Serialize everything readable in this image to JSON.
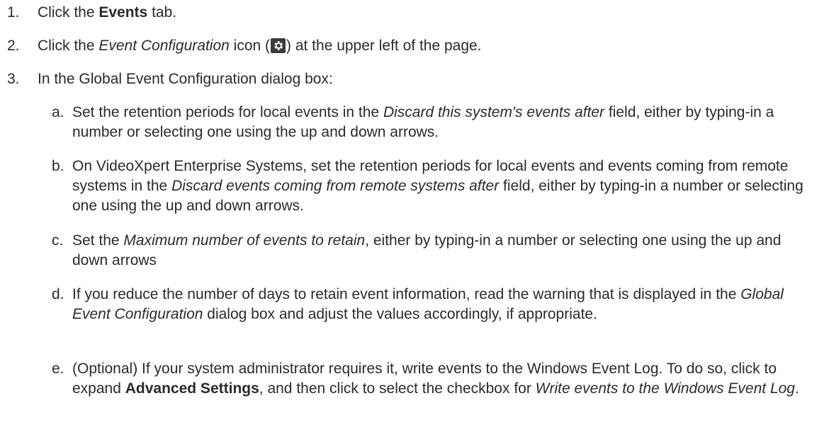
{
  "steps": [
    {
      "num": "1.",
      "parts": [
        "Click the ",
        "Events",
        " tab."
      ]
    },
    {
      "num": "2.",
      "parts": [
        "Click the ",
        "Event Configuration",
        " icon (",
        ") at the upper left of the page."
      ],
      "icon": "gear-icon",
      "icon_bg": "#3b3b3b",
      "icon_fg": "#e8e8e8"
    },
    {
      "num": "3.",
      "parts": [
        "In the Global Event Configuration dialog box:"
      ],
      "substeps": [
        {
          "letter": "a.",
          "parts": [
            "Set the retention periods for local events in the ",
            "Discard this system's events after",
            " field, either by typing-in a number or selecting one using the up and down arrows."
          ]
        },
        {
          "letter": "b.",
          "parts": [
            "On VideoXpert Enterprise Systems, set the retention periods for local events and events coming from remote systems in the ",
            "Discard events coming from remote systems after",
            " field, either by typing-in a number or selecting one using the up and down arrows."
          ]
        },
        {
          "letter": "c.",
          "parts": [
            "Set the ",
            "Maximum number of events to retain",
            ", either by typing-in a number or selecting one using the up and down arrows"
          ]
        },
        {
          "letter": "d.",
          "parts": [
            "If you reduce the number of days to retain event information, read the warning that is displayed in the ",
            "Global Event Configuration",
            " dialog box and adjust the values accordingly, if appropriate."
          ]
        },
        {
          "letter": "e.",
          "parts": [
            "(Optional) If your system administrator requires it, write events to the Windows Event Log. To do so, click to expand ",
            "Advanced Settings",
            ", and then click to select the checkbox for ",
            "Write events to the Windows Event Log",
            "."
          ]
        }
      ]
    }
  ]
}
